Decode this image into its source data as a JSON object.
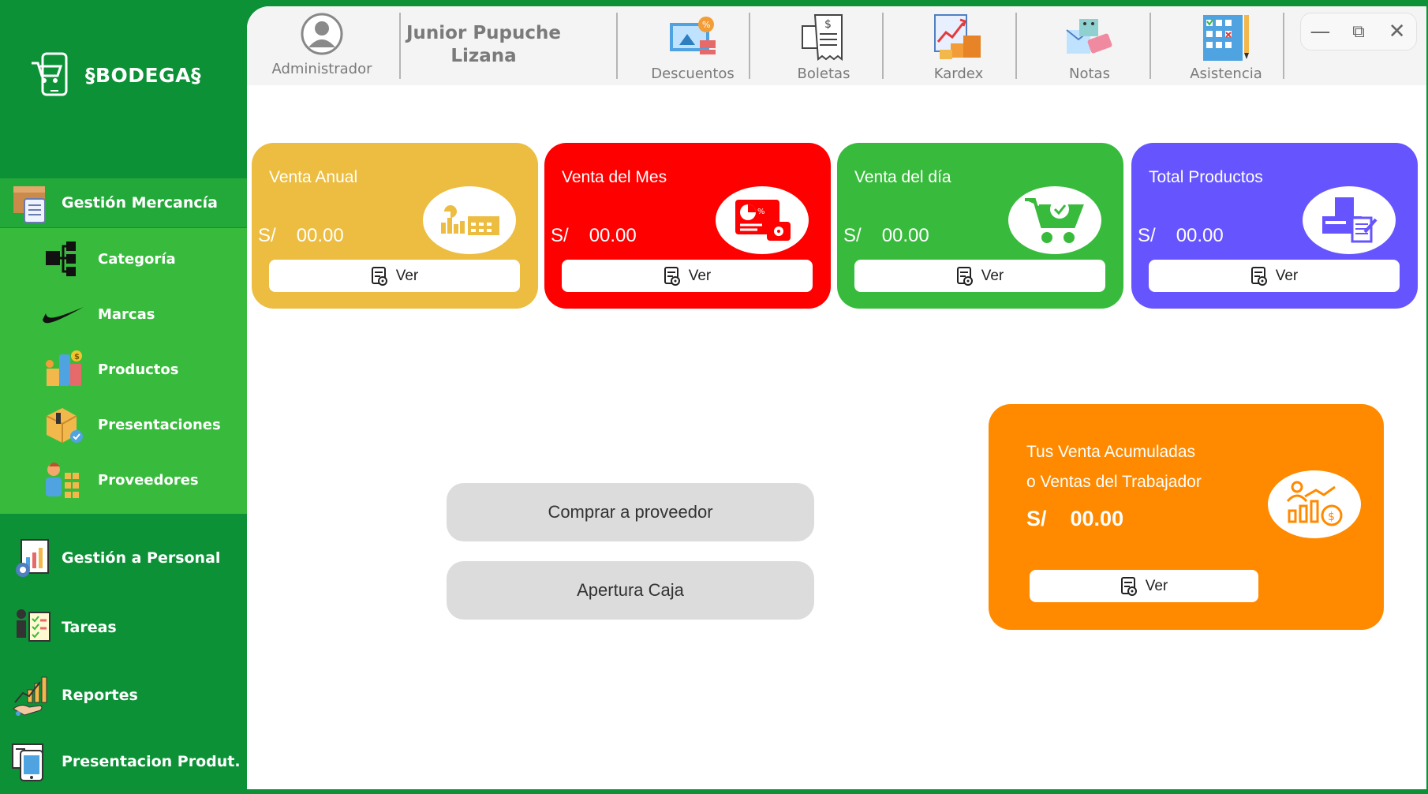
{
  "app": {
    "title": "§BODEGA§",
    "accent_green": "#0d9137",
    "submenu_green": "#38bb3c"
  },
  "sidebar": {
    "sections": [
      {
        "label": "Gestión Mercancía",
        "icon": "box-clipboard-icon",
        "active": true
      },
      {
        "label": "Gestión a Personal",
        "icon": "personnel-report-icon"
      },
      {
        "label": "Tareas",
        "icon": "tasks-icon"
      },
      {
        "label": "Reportes",
        "icon": "reports-chart-icon"
      },
      {
        "label": "Presentacion Produt.",
        "icon": "product-presentation-icon"
      }
    ],
    "submenu": [
      {
        "label": "Categoría",
        "icon": "category-cubes-icon"
      },
      {
        "label": "Marcas",
        "icon": "brand-swoosh-icon"
      },
      {
        "label": "Productos",
        "icon": "products-icon"
      },
      {
        "label": "Presentaciones",
        "icon": "package-icon"
      },
      {
        "label": "Proveedores",
        "icon": "supplier-icon"
      }
    ]
  },
  "topbar": {
    "role": "Administrador",
    "user_name": "Junior Pupuche\nLizana",
    "items": [
      {
        "label": "Descuentos",
        "icon": "discounts-icon"
      },
      {
        "label": "Boletas",
        "icon": "receipts-icon"
      },
      {
        "label": "Kardex",
        "icon": "kardex-icon"
      },
      {
        "label": "Notas",
        "icon": "notes-icon"
      },
      {
        "label": "Asistencia",
        "icon": "attendance-icon"
      }
    ]
  },
  "cards": [
    {
      "title": "Venta Anual",
      "currency": "S/",
      "value": "00.00",
      "button": "Ver",
      "color": "#ecbd41",
      "icon": "annual-chart-icon"
    },
    {
      "title": "Venta del Mes",
      "currency": "S/",
      "value": "00.00",
      "button": "Ver",
      "color": "#ff0000",
      "icon": "monthly-sales-icon"
    },
    {
      "title": "Venta del día",
      "currency": "S/",
      "value": "00.00",
      "button": "Ver",
      "color": "#38bb3c",
      "icon": "shopping-cart-icon"
    },
    {
      "title": "Total Productos",
      "currency": "S/",
      "value": "00.00",
      "button": "Ver",
      "color": "#6655ff",
      "icon": "products-total-icon"
    }
  ],
  "actions": {
    "buy_supplier": "Comprar a proveedor",
    "open_cash": "Apertura Caja"
  },
  "accumulated": {
    "line1": "Tus Venta Acumuladas",
    "line2": "o Ventas del Trabajador",
    "currency": "S/",
    "value": "00.00",
    "button": "Ver",
    "color": "#ff8a00"
  }
}
